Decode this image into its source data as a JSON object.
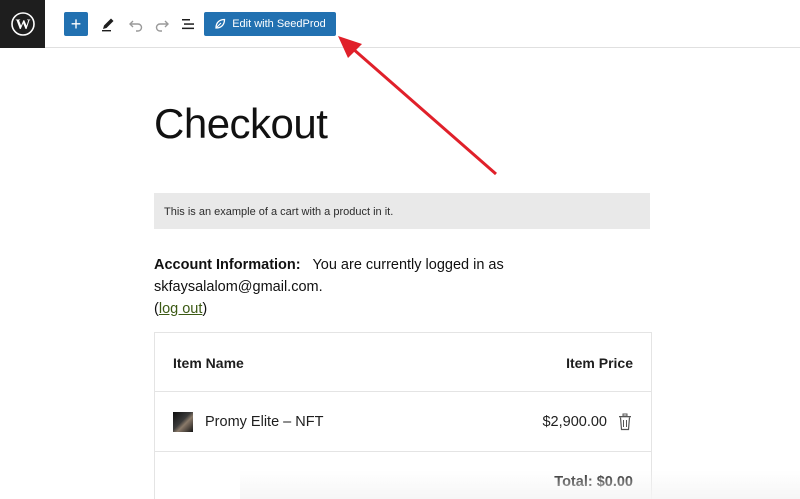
{
  "toolbar": {
    "logo_icon": "wordpress-logo-icon",
    "add_icon": "plus-icon",
    "add_symbol": "+",
    "tools_icon": "pencil-icon",
    "undo_icon": "undo-icon",
    "redo_icon": "redo-icon",
    "outline_icon": "list-view-icon",
    "seedprod_label": "Edit with SeedProd",
    "seedprod_icon": "seedprod-leaf-icon",
    "accent_color": "#2271b1"
  },
  "page": {
    "title": "Checkout",
    "notice": "This is an example of a cart with a product in it."
  },
  "account": {
    "label": "Account Information:",
    "text": "You are currently logged in as skfaysalalom@gmail.com.",
    "open_paren": "(",
    "logout_label": "log out",
    "close_paren": ")"
  },
  "cart": {
    "headers": {
      "name": "Item Name",
      "price": "Item Price"
    },
    "items": [
      {
        "name": "Promy Elite – NFT",
        "price": "$2,900.00",
        "remove_icon": "trash-icon"
      }
    ],
    "total": "Total: $0.00"
  },
  "annotation": {
    "arrow_color": "#e0202a"
  }
}
